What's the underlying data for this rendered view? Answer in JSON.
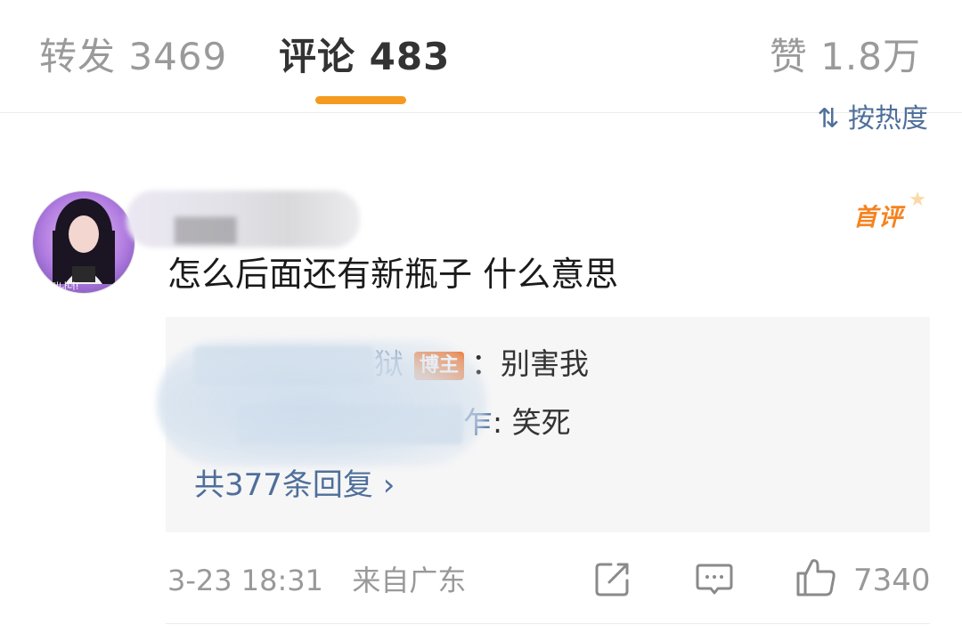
{
  "tabs": {
    "repost": "转发 3469",
    "comment": "评论 483",
    "like": "赞 1.8万"
  },
  "sort_label": "按热度",
  "comment": {
    "first_badge": "首评",
    "text": "怎么后面还有新瓶子 什么意思",
    "replies": [
      {
        "name_tail": "狱",
        "badge": "博主",
        "content": "：别害我"
      },
      {
        "name_tail": "乍",
        "content": ": 笑死"
      }
    ],
    "more_replies": "共377条回复 ›",
    "time": "3-23 18:31",
    "location": "来自广东",
    "like_count": "7340"
  },
  "colors": {
    "accent": "#f59a1f",
    "link": "#4f6f9a",
    "badge": "#f36f21"
  },
  "icons": [
    "share-icon",
    "comment-icon",
    "thumbs-up-icon"
  ]
}
